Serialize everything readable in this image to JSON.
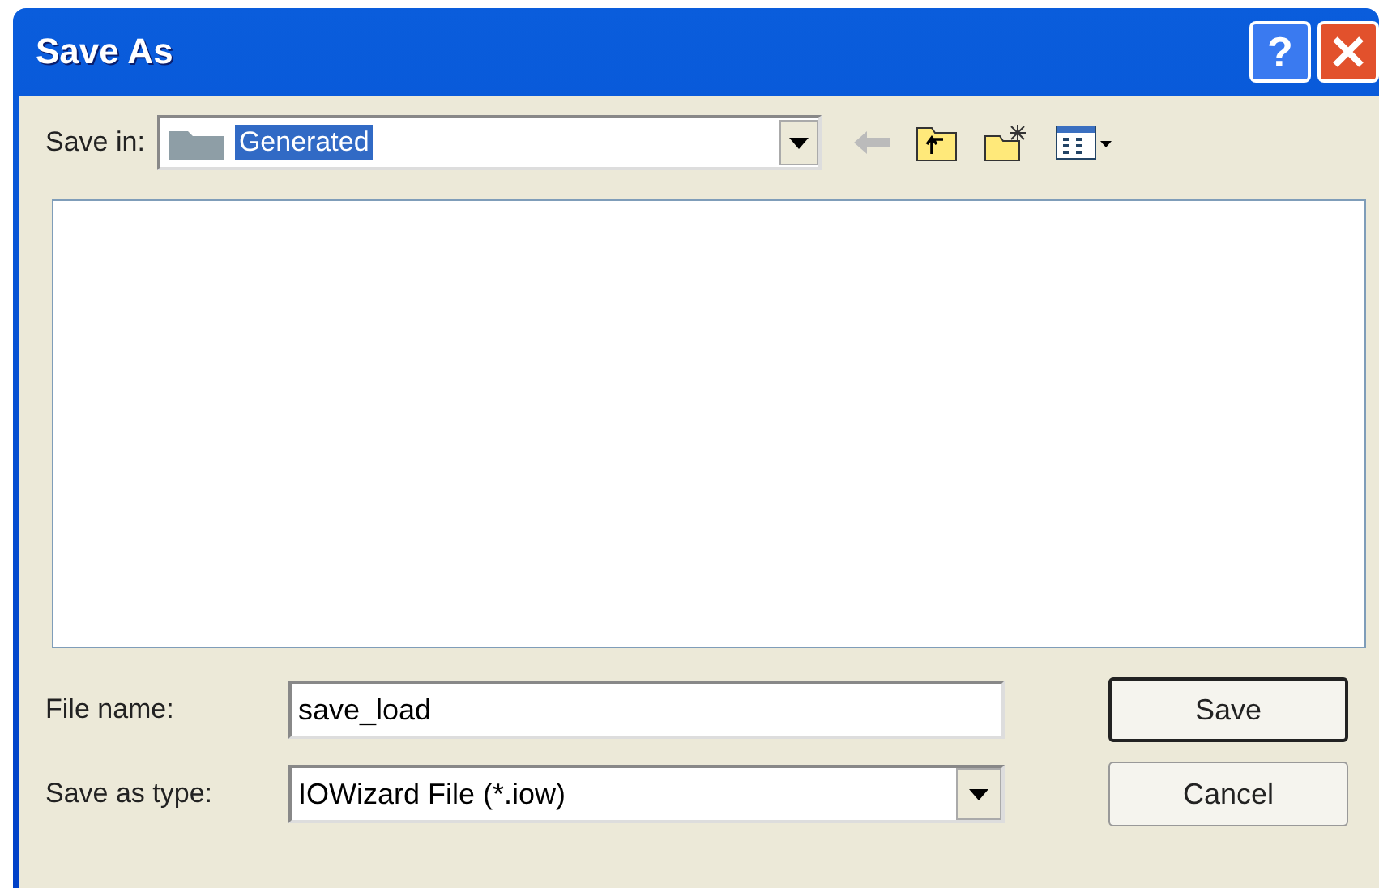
{
  "window": {
    "title": "Save As",
    "help_button": "?"
  },
  "save_in": {
    "label": "Save in:",
    "value": "Generated"
  },
  "file_name": {
    "label": "File name:",
    "value": "save_load"
  },
  "save_as_type": {
    "label": "Save as type:",
    "value": "IOWizard File (*.iow)"
  },
  "buttons": [
    {
      "label": "Save",
      "default": true
    },
    {
      "label": "Cancel",
      "default": false
    }
  ]
}
